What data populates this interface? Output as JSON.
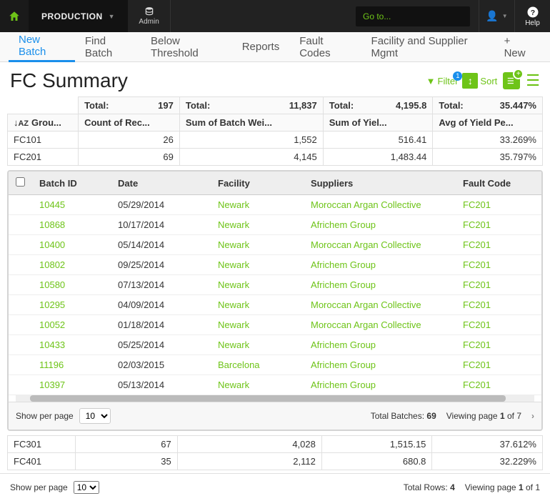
{
  "topbar": {
    "production_label": "PRODUCTION",
    "admin_label": "Admin",
    "goto_placeholder": "Go to...",
    "help_label": "Help"
  },
  "tabs": {
    "items": [
      "New Batch",
      "Find Batch",
      "Below Threshold",
      "Reports",
      "Fault Codes",
      "Facility and Supplier Mgmt"
    ],
    "new_label": "+ New"
  },
  "page": {
    "title": "FC Summary",
    "filter_label": "Filter",
    "filter_count": "1",
    "sort_label": "Sort"
  },
  "summary": {
    "totals_row": {
      "label": "Total:",
      "count": "197",
      "batch_weight": "11,837",
      "yield": "4,195.8",
      "avg_yield": "35.447%"
    },
    "header_row": {
      "group": "Grou...",
      "count": "Count of Rec...",
      "batch_weight": "Sum of Batch Wei...",
      "yield": "Sum of Yiel...",
      "avg_yield": "Avg of Yield Pe..."
    },
    "rows_top": [
      {
        "group": "FC101",
        "count": "26",
        "batch_weight": "1,552",
        "yield": "516.41",
        "avg_yield": "33.269%"
      },
      {
        "group": "FC201",
        "count": "69",
        "batch_weight": "4,145",
        "yield": "1,483.44",
        "avg_yield": "35.797%"
      }
    ],
    "rows_bottom": [
      {
        "group": "FC301",
        "count": "67",
        "batch_weight": "4,028",
        "yield": "1,515.15",
        "avg_yield": "37.612%"
      },
      {
        "group": "FC401",
        "count": "35",
        "batch_weight": "2,112",
        "yield": "680.8",
        "avg_yield": "32.229%"
      }
    ]
  },
  "detail": {
    "headers": {
      "batch_id": "Batch ID",
      "date": "Date",
      "facility": "Facility",
      "suppliers": "Suppliers",
      "fault_code": "Fault Code"
    },
    "rows": [
      {
        "id": "10445",
        "date": "05/29/2014",
        "facility": "Newark",
        "supplier": "Moroccan Argan Collective",
        "code": "FC201"
      },
      {
        "id": "10868",
        "date": "10/17/2014",
        "facility": "Newark",
        "supplier": "Africhem Group",
        "code": "FC201"
      },
      {
        "id": "10400",
        "date": "05/14/2014",
        "facility": "Newark",
        "supplier": "Moroccan Argan Collective",
        "code": "FC201"
      },
      {
        "id": "10802",
        "date": "09/25/2014",
        "facility": "Newark",
        "supplier": "Africhem Group",
        "code": "FC201"
      },
      {
        "id": "10580",
        "date": "07/13/2014",
        "facility": "Newark",
        "supplier": "Africhem Group",
        "code": "FC201"
      },
      {
        "id": "10295",
        "date": "04/09/2014",
        "facility": "Newark",
        "supplier": "Moroccan Argan Collective",
        "code": "FC201"
      },
      {
        "id": "10052",
        "date": "01/18/2014",
        "facility": "Newark",
        "supplier": "Moroccan Argan Collective",
        "code": "FC201"
      },
      {
        "id": "10433",
        "date": "05/25/2014",
        "facility": "Newark",
        "supplier": "Africhem Group",
        "code": "FC201"
      },
      {
        "id": "11196",
        "date": "02/03/2015",
        "facility": "Barcelona",
        "supplier": "Africhem Group",
        "code": "FC201"
      },
      {
        "id": "10397",
        "date": "05/13/2014",
        "facility": "Newark",
        "supplier": "Africhem Group",
        "code": "FC201"
      }
    ],
    "footer": {
      "show_label": "Show per page",
      "page_size": "10",
      "total_label": "Total Batches:",
      "total_value": "69",
      "viewing_prefix": "Viewing page",
      "viewing_page": "1",
      "viewing_of": "of 7"
    }
  },
  "outer_footer": {
    "show_label": "Show per page",
    "page_size": "10",
    "total_label": "Total Rows:",
    "total_value": "4",
    "viewing_prefix": "Viewing page",
    "viewing_page": "1",
    "viewing_of": "of 1"
  }
}
